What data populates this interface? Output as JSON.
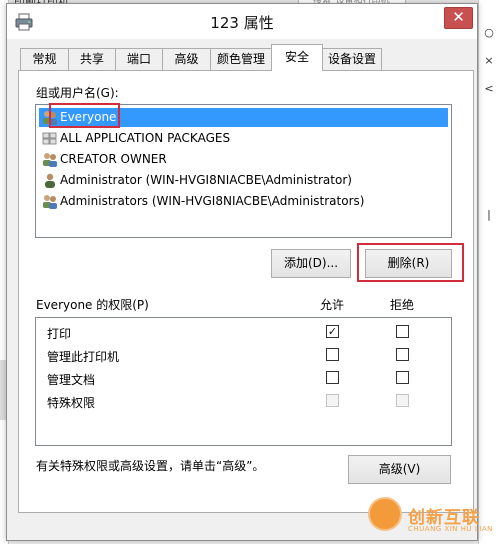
{
  "background": {
    "top_text": "印刷打印机",
    "search_placeholder": "搜索“设备和打印机”",
    "right_items": [
      "○",
      "×",
      "<",
      "|"
    ]
  },
  "dialog": {
    "title": "123 属性",
    "close_label": "✕"
  },
  "tabs": [
    "常规",
    "共享",
    "端口",
    "高级",
    "颜色管理",
    "安全",
    "设备设置"
  ],
  "active_tab": 5,
  "security": {
    "group_label": "组或用户名(G):",
    "users": [
      {
        "name": "Everyone",
        "icon": "group-icon",
        "selected": true
      },
      {
        "name": "ALL APPLICATION PACKAGES",
        "icon": "package-icon",
        "selected": false
      },
      {
        "name": "CREATOR OWNER",
        "icon": "group-icon",
        "selected": false
      },
      {
        "name": "Administrator (WIN-HVGI8NIACBE\\Administrator)",
        "icon": "user-icon",
        "selected": false
      },
      {
        "name": "Administrators (WIN-HVGI8NIACBE\\Administrators)",
        "icon": "group-icon",
        "selected": false
      }
    ],
    "add_button": "添加(D)...",
    "remove_button": "删除(R)",
    "perm_header": "Everyone 的权限(P)",
    "allow_header": "允许",
    "deny_header": "拒绝",
    "permissions": [
      {
        "name": "打印",
        "allow": true,
        "deny": false,
        "enabled": true
      },
      {
        "name": "管理此打印机",
        "allow": false,
        "deny": false,
        "enabled": true
      },
      {
        "name": "管理文档",
        "allow": false,
        "deny": false,
        "enabled": true
      },
      {
        "name": "特殊权限",
        "allow": false,
        "deny": false,
        "enabled": false
      }
    ],
    "advanced_hint": "有关特殊权限或高级设置，请单击“高级”。",
    "advanced_button": "高级(V)"
  },
  "watermark": {
    "text": "创新互联",
    "sub": "CHUANG XIN HU LIAN"
  },
  "colors": {
    "selection": "#3399ff",
    "highlight_box": "#d12d3a",
    "close_button": "#c75050"
  }
}
